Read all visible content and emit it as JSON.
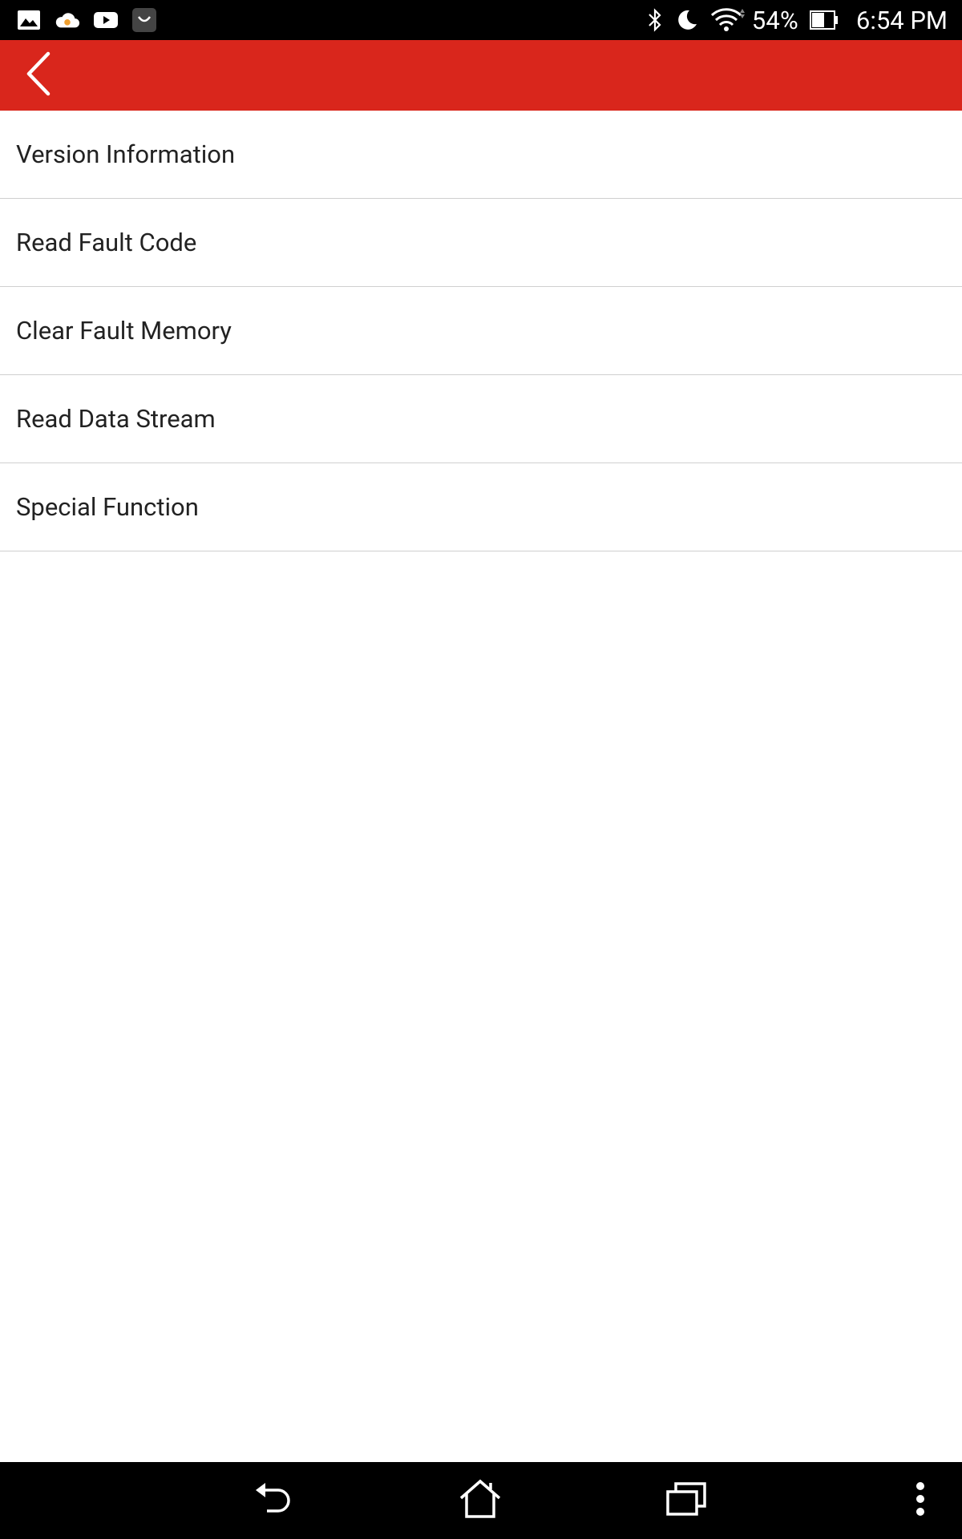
{
  "status_bar": {
    "battery_percent": "54%",
    "time": "6:54 PM",
    "left_icons": [
      "gallery-icon",
      "cloud-icon",
      "youtube-icon",
      "app-icon"
    ],
    "right_icons": [
      "bluetooth-icon",
      "do-not-disturb-moon-icon",
      "wifi-icon",
      "battery-icon"
    ]
  },
  "toolbar": {
    "back_icon": "chevron-left-icon",
    "color": "#d9261c"
  },
  "menu": {
    "items": [
      {
        "label": "Version Information"
      },
      {
        "label": "Read Fault Code"
      },
      {
        "label": "Clear Fault Memory"
      },
      {
        "label": "Read Data Stream"
      },
      {
        "label": "Special Function"
      }
    ]
  },
  "nav_bar": {
    "icons": [
      "back-arrow-icon",
      "home-icon",
      "recent-apps-icon",
      "overflow-menu-icon"
    ]
  }
}
